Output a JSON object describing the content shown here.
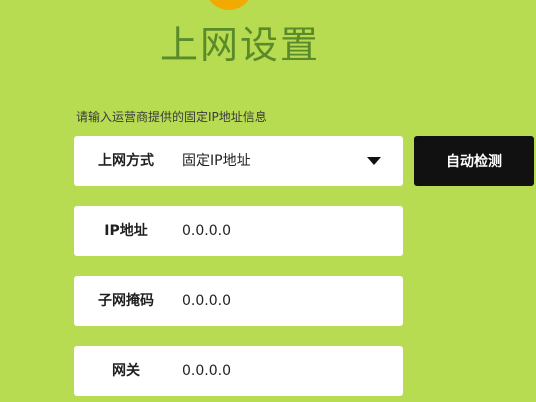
{
  "page": {
    "title": "上网设置",
    "hint": "请输入运营商提供的固定IP地址信息"
  },
  "form": {
    "connection_type": {
      "label": "上网方式",
      "value": "固定IP地址"
    },
    "ip_address": {
      "label": "IP地址",
      "value": "0.0.0.0"
    },
    "subnet_mask": {
      "label": "子网掩码",
      "value": "0.0.0.0"
    },
    "gateway": {
      "label": "网关",
      "value": "0.0.0.0"
    }
  },
  "actions": {
    "auto_detect_label": "自动检测"
  },
  "colors": {
    "background": "#b7dc52",
    "title": "#5a8a2a",
    "field_background": "#ffffff",
    "button_background": "#111111",
    "button_text": "#ffffff",
    "logo": "#f2a900"
  },
  "icons": {
    "dropdown": "triangle-down-icon",
    "logo": "logo-icon"
  }
}
